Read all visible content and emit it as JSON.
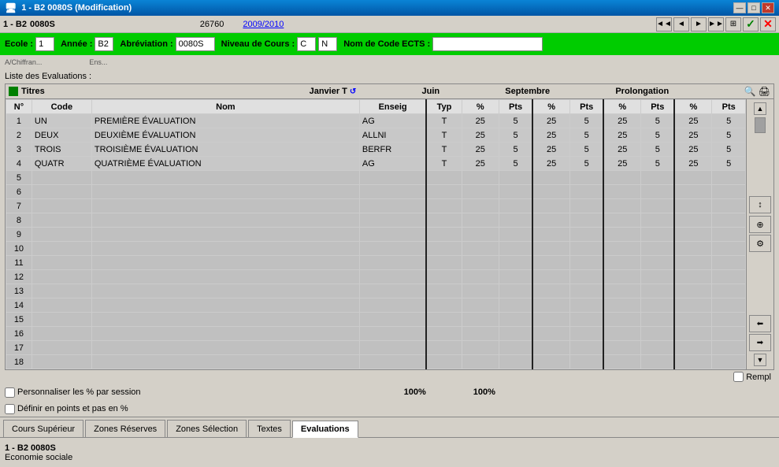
{
  "titleBar": {
    "title": "1 - B2   0080S   (Modification)",
    "minBtn": "—",
    "maxBtn": "□",
    "closeBtn": "✕"
  },
  "menuBar": {
    "label": "1 - B2",
    "code": "0080S",
    "number": "26760",
    "year": "2009/2010",
    "navBtns": [
      "◄◄",
      "◄",
      "►",
      "►►",
      "⊞",
      "✓",
      "✕"
    ]
  },
  "formBar": {
    "ecoleLabel": "Ecole :",
    "ecoleValue": "1",
    "anneeLabel": "Année :",
    "anneeValue": "B2",
    "abrevLabel": "Abréviation :",
    "abrevValue": "0080S",
    "niveauLabel": "Niveau de Cours :",
    "niveauValue1": "C",
    "niveauValue2": "N",
    "nomEctsLabel": "Nom de Code ECTS :",
    "nomEctsValue": ""
  },
  "subFormRow": {
    "text1": "A/Chiffran...",
    "text2": "Ens..."
  },
  "sectionHeader": "Liste des Evaluations :",
  "colHeaders": {
    "titres": "Titres",
    "janvierT": "Janvier T",
    "juin": "Juin",
    "septembre": "Septembre",
    "prolongation": "Prolongation"
  },
  "tableHeaders": {
    "n": "N°",
    "code": "Code",
    "nom": "Nom",
    "enseig": "Enseig",
    "typ": "Typ",
    "pct": "%",
    "pts": "Pts"
  },
  "rows": [
    {
      "n": "1",
      "code": "UN",
      "nom": "PREMIÈRE ÉVALUATION",
      "enseig": "AG",
      "typ": "T",
      "j_pct": "25",
      "j_pts": "5",
      "ju_pct": "25",
      "ju_pts": "5",
      "s_pct": "25",
      "s_pts": "5",
      "p_pct": "25",
      "p_pts": "5"
    },
    {
      "n": "2",
      "code": "DEUX",
      "nom": "DEUXIÈME ÉVALUATION",
      "enseig": "ALLNI",
      "typ": "T",
      "j_pct": "25",
      "j_pts": "5",
      "ju_pct": "25",
      "ju_pts": "5",
      "s_pct": "25",
      "s_pts": "5",
      "p_pct": "25",
      "p_pts": "5"
    },
    {
      "n": "3",
      "code": "TROIS",
      "nom": "TROISIÈME ÉVALUATION",
      "enseig": "BERFR",
      "typ": "T",
      "j_pct": "25",
      "j_pts": "5",
      "ju_pct": "25",
      "ju_pts": "5",
      "s_pct": "25",
      "s_pts": "5",
      "p_pct": "25",
      "p_pts": "5"
    },
    {
      "n": "4",
      "code": "QUATR",
      "nom": "QUATRIÈME ÉVALUATION",
      "enseig": "AG",
      "typ": "T",
      "j_pct": "25",
      "j_pts": "5",
      "ju_pct": "25",
      "ju_pts": "5",
      "s_pct": "25",
      "s_pts": "5",
      "p_pct": "25",
      "p_pts": "5"
    },
    {
      "n": "5",
      "code": "",
      "nom": "",
      "enseig": "",
      "typ": "",
      "j_pct": "",
      "j_pts": "",
      "ju_pct": "",
      "ju_pts": "",
      "s_pct": "",
      "s_pts": "",
      "p_pct": "",
      "p_pts": ""
    },
    {
      "n": "6",
      "code": "",
      "nom": "",
      "enseig": "",
      "typ": "",
      "j_pct": "",
      "j_pts": "",
      "ju_pct": "",
      "ju_pts": "",
      "s_pct": "",
      "s_pts": "",
      "p_pct": "",
      "p_pts": ""
    },
    {
      "n": "7",
      "code": "",
      "nom": "",
      "enseig": "",
      "typ": "",
      "j_pct": "",
      "j_pts": "",
      "ju_pct": "",
      "ju_pts": "",
      "s_pct": "",
      "s_pts": "",
      "p_pct": "",
      "p_pts": ""
    },
    {
      "n": "8",
      "code": "",
      "nom": "",
      "enseig": "",
      "typ": "",
      "j_pct": "",
      "j_pts": "",
      "ju_pct": "",
      "ju_pts": "",
      "s_pct": "",
      "s_pts": "",
      "p_pct": "",
      "p_pts": ""
    },
    {
      "n": "9",
      "code": "",
      "nom": "",
      "enseig": "",
      "typ": "",
      "j_pct": "",
      "j_pts": "",
      "ju_pct": "",
      "ju_pts": "",
      "s_pct": "",
      "s_pts": "",
      "p_pct": "",
      "p_pts": ""
    },
    {
      "n": "10",
      "code": "",
      "nom": "",
      "enseig": "",
      "typ": "",
      "j_pct": "",
      "j_pts": "",
      "ju_pct": "",
      "ju_pts": "",
      "s_pct": "",
      "s_pts": "",
      "p_pct": "",
      "p_pts": ""
    },
    {
      "n": "11",
      "code": "",
      "nom": "",
      "enseig": "",
      "typ": "",
      "j_pct": "",
      "j_pts": "",
      "ju_pct": "",
      "ju_pts": "",
      "s_pct": "",
      "s_pts": "",
      "p_pct": "",
      "p_pts": ""
    },
    {
      "n": "12",
      "code": "",
      "nom": "",
      "enseig": "",
      "typ": "",
      "j_pct": "",
      "j_pts": "",
      "ju_pct": "",
      "ju_pts": "",
      "s_pct": "",
      "s_pts": "",
      "p_pct": "",
      "p_pts": ""
    },
    {
      "n": "13",
      "code": "",
      "nom": "",
      "enseig": "",
      "typ": "",
      "j_pct": "",
      "j_pts": "",
      "ju_pct": "",
      "ju_pts": "",
      "s_pct": "",
      "s_pts": "",
      "p_pct": "",
      "p_pts": ""
    },
    {
      "n": "14",
      "code": "",
      "nom": "",
      "enseig": "",
      "typ": "",
      "j_pct": "",
      "j_pts": "",
      "ju_pct": "",
      "ju_pts": "",
      "s_pct": "",
      "s_pts": "",
      "p_pct": "",
      "p_pts": ""
    },
    {
      "n": "15",
      "code": "",
      "nom": "",
      "enseig": "",
      "typ": "",
      "j_pct": "",
      "j_pts": "",
      "ju_pct": "",
      "ju_pts": "",
      "s_pct": "",
      "s_pts": "",
      "p_pct": "",
      "p_pts": ""
    },
    {
      "n": "16",
      "code": "",
      "nom": "",
      "enseig": "",
      "typ": "",
      "j_pct": "",
      "j_pts": "",
      "ju_pct": "",
      "ju_pts": "",
      "s_pct": "",
      "s_pts": "",
      "p_pct": "",
      "p_pts": ""
    },
    {
      "n": "17",
      "code": "",
      "nom": "",
      "enseig": "",
      "typ": "",
      "j_pct": "",
      "j_pts": "",
      "ju_pct": "",
      "ju_pts": "",
      "s_pct": "",
      "s_pts": "",
      "p_pct": "",
      "p_pts": ""
    },
    {
      "n": "18",
      "code": "",
      "nom": "",
      "enseig": "",
      "typ": "",
      "j_pct": "",
      "j_pts": "",
      "ju_pct": "",
      "ju_pts": "",
      "s_pct": "",
      "s_pts": "",
      "p_pct": "",
      "p_pts": ""
    }
  ],
  "bottomChecks": {
    "check1Label": "Personnaliser les % par session",
    "check2Label": "Définir en points et pas en %",
    "pct1": "100%",
    "pct2": "100%",
    "remplLabel": "Rempl"
  },
  "tabs": [
    {
      "label": "Cours Supérieur",
      "active": false
    },
    {
      "label": "Zones Réserves",
      "active": false
    },
    {
      "label": "Zones Sélection",
      "active": false
    },
    {
      "label": "Textes",
      "active": false
    },
    {
      "label": "Evaluations",
      "active": true
    }
  ],
  "statusBar": {
    "line1": "1 - B2   0080S",
    "line2": "Economie sociale"
  }
}
